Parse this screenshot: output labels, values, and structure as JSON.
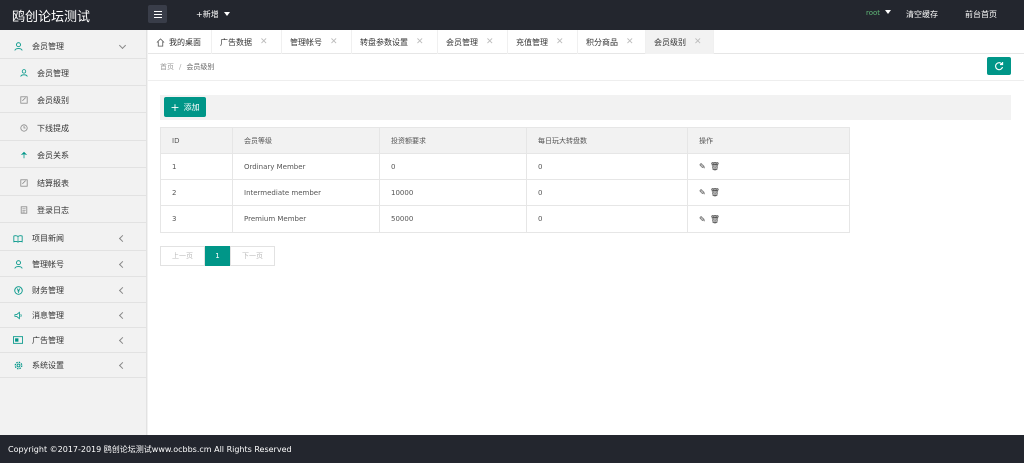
{
  "header": {
    "logo": "鸥创论坛测试",
    "new_label": "+新增",
    "user": "root",
    "clear_cache": "清空缓存",
    "front_page": "前台首页"
  },
  "sidebar": {
    "items": [
      {
        "label": "会员管理",
        "icon": "user-icon",
        "level": "group",
        "state": "expanded"
      },
      {
        "label": "会员管理",
        "icon": "user-icon",
        "level": "child"
      },
      {
        "label": "会员级别",
        "icon": "edit-icon",
        "level": "child"
      },
      {
        "label": "下线提成",
        "icon": "clock-icon",
        "level": "child"
      },
      {
        "label": "会员关系",
        "icon": "tree-icon",
        "level": "child"
      },
      {
        "label": "结算报表",
        "icon": "edit-icon",
        "level": "child"
      },
      {
        "label": "登录日志",
        "icon": "log-icon",
        "level": "child"
      },
      {
        "label": "项目新闻",
        "icon": "book-icon",
        "level": "group",
        "state": "collapsed"
      },
      {
        "label": "管理帐号",
        "icon": "user-icon",
        "level": "group",
        "state": "collapsed"
      },
      {
        "label": "财务管理",
        "icon": "yen-icon",
        "level": "group",
        "state": "collapsed"
      },
      {
        "label": "消息管理",
        "icon": "speaker-icon",
        "level": "group",
        "state": "collapsed"
      },
      {
        "label": "广告管理",
        "icon": "ad-icon",
        "level": "group",
        "state": "collapsed"
      },
      {
        "label": "系统设置",
        "icon": "gear-icon",
        "level": "group",
        "state": "collapsed"
      }
    ]
  },
  "tabs": [
    {
      "label": "我的桌面",
      "closable": false
    },
    {
      "label": "广告数据",
      "closable": true
    },
    {
      "label": "管理帐号",
      "closable": true
    },
    {
      "label": "转盘参数设置",
      "closable": true
    },
    {
      "label": "会员管理",
      "closable": true
    },
    {
      "label": "充值管理",
      "closable": true
    },
    {
      "label": "积分商品",
      "closable": true
    },
    {
      "label": "会员级别",
      "closable": true,
      "active": true
    }
  ],
  "breadcrumb": {
    "home": "首页",
    "separator": "/",
    "current": "会员级别"
  },
  "toolbar": {
    "add_label": "添加"
  },
  "table": {
    "headers": [
      "ID",
      "会员等级",
      "投资额要求",
      "每日玩大转盘数",
      "操作"
    ],
    "rows": [
      [
        "1",
        "Ordinary Member",
        "0",
        "0"
      ],
      [
        "2",
        "Intermediate member",
        "10000",
        "0"
      ],
      [
        "3",
        "Premium Member",
        "50000",
        "0"
      ]
    ]
  },
  "pager": {
    "prev": "上一页",
    "current": "1",
    "next": "下一页"
  },
  "footer": {
    "text": "Copyright ©2017-2019 鸥创论坛测试www.ocbbs.cm All Rights Reserved"
  },
  "colors": {
    "accent": "#009688",
    "topbar": "#23262e",
    "user": "#5fb878"
  }
}
